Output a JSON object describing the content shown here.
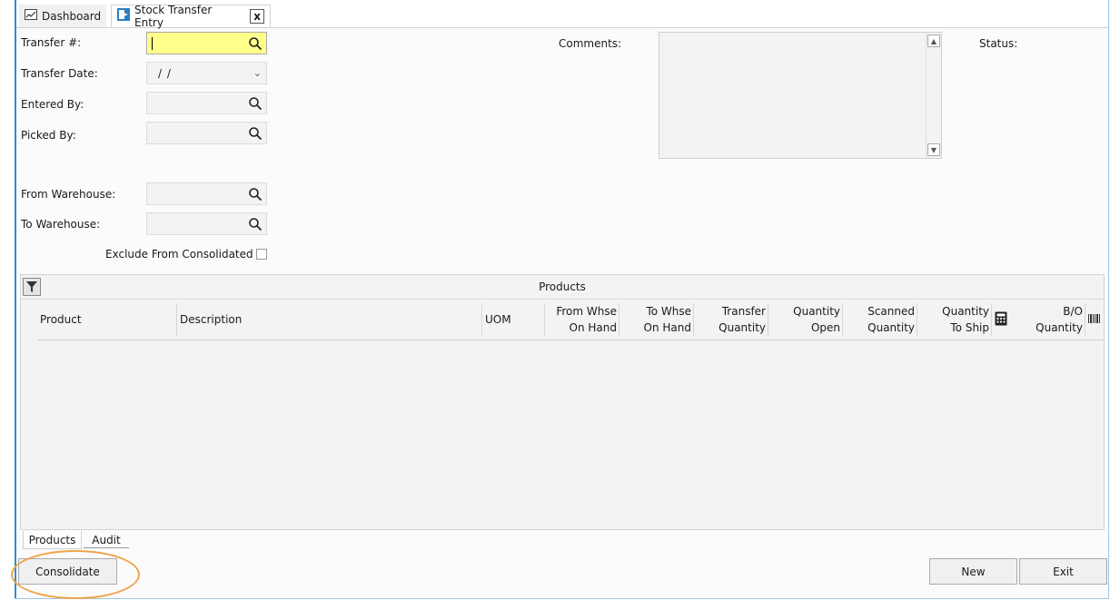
{
  "tabs": [
    {
      "label": "Dashboard",
      "icon": "chart-icon"
    },
    {
      "label": "Stock Transfer Entry",
      "icon": "transfer-icon",
      "close": "x"
    }
  ],
  "form": {
    "transfer_no_label": "Transfer #:",
    "transfer_date_label": "Transfer Date:",
    "transfer_date_value": "/ /",
    "entered_by_label": "Entered By:",
    "picked_by_label": "Picked By:",
    "from_warehouse_label": "From Warehouse:",
    "to_warehouse_label": "To Warehouse:",
    "exclude_label": "Exclude From Consolidated",
    "comments_label": "Comments:",
    "status_label": "Status:"
  },
  "grid": {
    "title": "Products",
    "columns": [
      {
        "l1": "Product",
        "l2": ""
      },
      {
        "l1": "Description",
        "l2": ""
      },
      {
        "l1": "UOM",
        "l2": ""
      },
      {
        "l1": "From Whse",
        "l2": "On Hand"
      },
      {
        "l1": "To Whse",
        "l2": "On Hand"
      },
      {
        "l1": "Transfer",
        "l2": "Quantity"
      },
      {
        "l1": "Quantity",
        "l2": "Open"
      },
      {
        "l1": "Scanned",
        "l2": "Quantity"
      },
      {
        "l1": "Quantity",
        "l2": "To Ship"
      },
      {
        "l1": "B/O",
        "l2": "Quantity"
      }
    ]
  },
  "bottom_tabs": [
    "Products",
    "Audit"
  ],
  "buttons": {
    "consolidate": "Consolidate",
    "new": "New",
    "exit": "Exit"
  },
  "colors": {
    "active_field": "#ffff8c",
    "frame_accent": "#2e8fd0",
    "highlight_ring": "#f0a54c"
  }
}
